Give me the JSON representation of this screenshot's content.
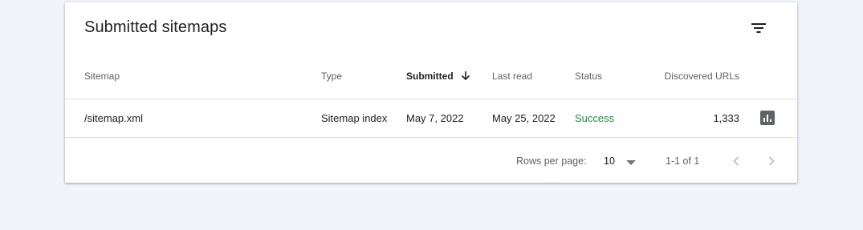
{
  "card": {
    "title": "Submitted sitemaps"
  },
  "icons": {
    "filter": "filter-list-icon",
    "sort": "arrow-downward-icon",
    "report": "bar-chart-icon",
    "prev": "chevron-left-icon",
    "next": "chevron-right-icon",
    "dropdown": "arrow-drop-down-icon"
  },
  "table": {
    "columns": {
      "sitemap": "Sitemap",
      "type": "Type",
      "submitted": "Submitted",
      "last_read": "Last read",
      "status": "Status",
      "discovered_urls": "Discovered URLs"
    },
    "sort_column": "submitted",
    "sort_direction": "descending",
    "rows": [
      {
        "sitemap": "/sitemap.xml",
        "type": "Sitemap index",
        "submitted": "May 7, 2022",
        "last_read": "May 25, 2022",
        "status": "Success",
        "discovered_urls": "1,333"
      }
    ]
  },
  "pagination": {
    "rows_per_page_label": "Rows per page:",
    "rows_per_page_value": "10",
    "range_label": "1-1 of 1"
  },
  "colors": {
    "background": "#f1f4fb",
    "card": "#ffffff",
    "status_success": "#1e8e3e",
    "text_primary": "#202124",
    "text_secondary": "#5f6368",
    "icon_gray": "#5f6368",
    "disabled": "#bdbdbd"
  }
}
